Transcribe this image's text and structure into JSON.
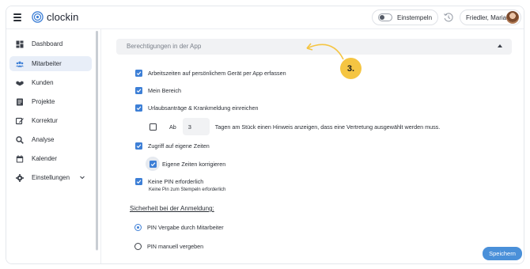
{
  "header": {
    "app_name": "clockin",
    "clock_in_label": "Einstempeln",
    "user_name": "Friedler, Maria",
    "accent_color": "#3d7fd6"
  },
  "sidebar": {
    "items": [
      {
        "label": "Dashboard",
        "icon": "dashboard-icon",
        "active": false
      },
      {
        "label": "Mitarbeiter",
        "icon": "people-icon",
        "active": true
      },
      {
        "label": "Kunden",
        "icon": "handshake-icon",
        "active": false
      },
      {
        "label": "Projekte",
        "icon": "folder-icon",
        "active": false
      },
      {
        "label": "Korrektur",
        "icon": "edit-icon",
        "active": false
      },
      {
        "label": "Analyse",
        "icon": "search-icon",
        "active": false
      },
      {
        "label": "Kalender",
        "icon": "calendar-icon",
        "active": false
      },
      {
        "label": "Einstellungen",
        "icon": "gear-icon",
        "active": false,
        "has_submenu": true
      }
    ]
  },
  "annotation": {
    "step": "3."
  },
  "section": {
    "title": "Berechtigungen in der App",
    "options": {
      "arbeitszeiten": {
        "label": "Arbeitszeiten auf persönlichem Gerät per App erfassen",
        "checked": true
      },
      "mein_bereich": {
        "label": "Mein Bereich",
        "checked": true
      },
      "urlaub": {
        "label": "Urlaubsanträge & Krankmeldung einreichen",
        "checked": true
      },
      "hinweis": {
        "prefix": "Ab",
        "value": "3",
        "suffix": "Tagen am Stück einen Hinweis anzeigen, dass eine Vertretung ausgewählt werden muss.",
        "checked": false
      },
      "eigene_zeiten": {
        "label": "Zugriff auf eigene Zeiten",
        "checked": true
      },
      "korrigieren": {
        "label": "Eigene Zeiten korrigieren",
        "checked": true
      },
      "keine_pin": {
        "label": "Keine PIN erforderlich",
        "sublabel": "Keine Pin zum Stempeln erforderlich",
        "checked": true
      }
    },
    "security": {
      "heading": "Sicherheit bei der Anmeldung:",
      "radio_1": {
        "label": "PIN Vergabe durch Mitarbeiter",
        "selected": true
      },
      "radio_2": {
        "label": "PIN manuell vergeben",
        "selected": false
      }
    }
  },
  "save_label": "Speichern"
}
